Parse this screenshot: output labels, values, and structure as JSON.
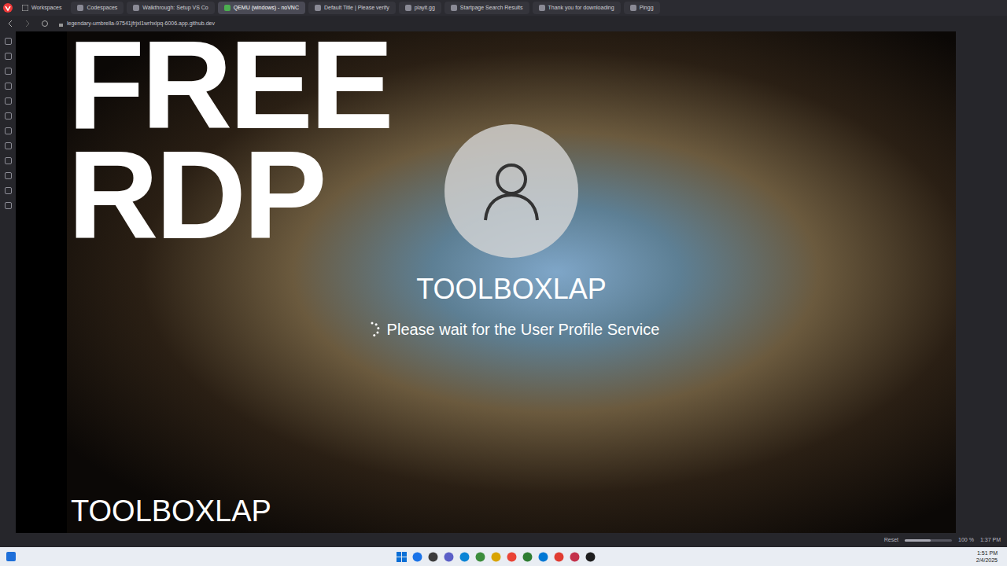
{
  "browser": {
    "workspaces": "Workspaces",
    "tabs": [
      {
        "label": "Codespaces",
        "selected": false
      },
      {
        "label": "Walkthrough: Setup VS Co",
        "selected": false
      },
      {
        "label": "QEMU (windows) - noVNC",
        "selected": true
      },
      {
        "label": "Default Title | Please verify",
        "selected": false
      },
      {
        "label": "playit.gg",
        "selected": false
      },
      {
        "label": "Startpage Search Results",
        "selected": false
      },
      {
        "label": "Thank you for downloading",
        "selected": false
      },
      {
        "label": "Pingg",
        "selected": false
      }
    ],
    "url": "legendary-umbrella-97541jfrjxl1wrhxlpq-6006.app.github.dev"
  },
  "overlay": {
    "title_lines": [
      "FREE",
      "RDP"
    ],
    "watermark": "TOOLBOXLAP"
  },
  "login": {
    "user": "TOOLBOXLAP",
    "status": "Please wait for the User Profile Service"
  },
  "status_bar": {
    "reset": "Reset",
    "zoom": "100 %",
    "zoom_level": 0.55,
    "time": "1:37 PM"
  },
  "taskbar": {
    "time": "1:51 PM",
    "date": "2/4/2025"
  }
}
